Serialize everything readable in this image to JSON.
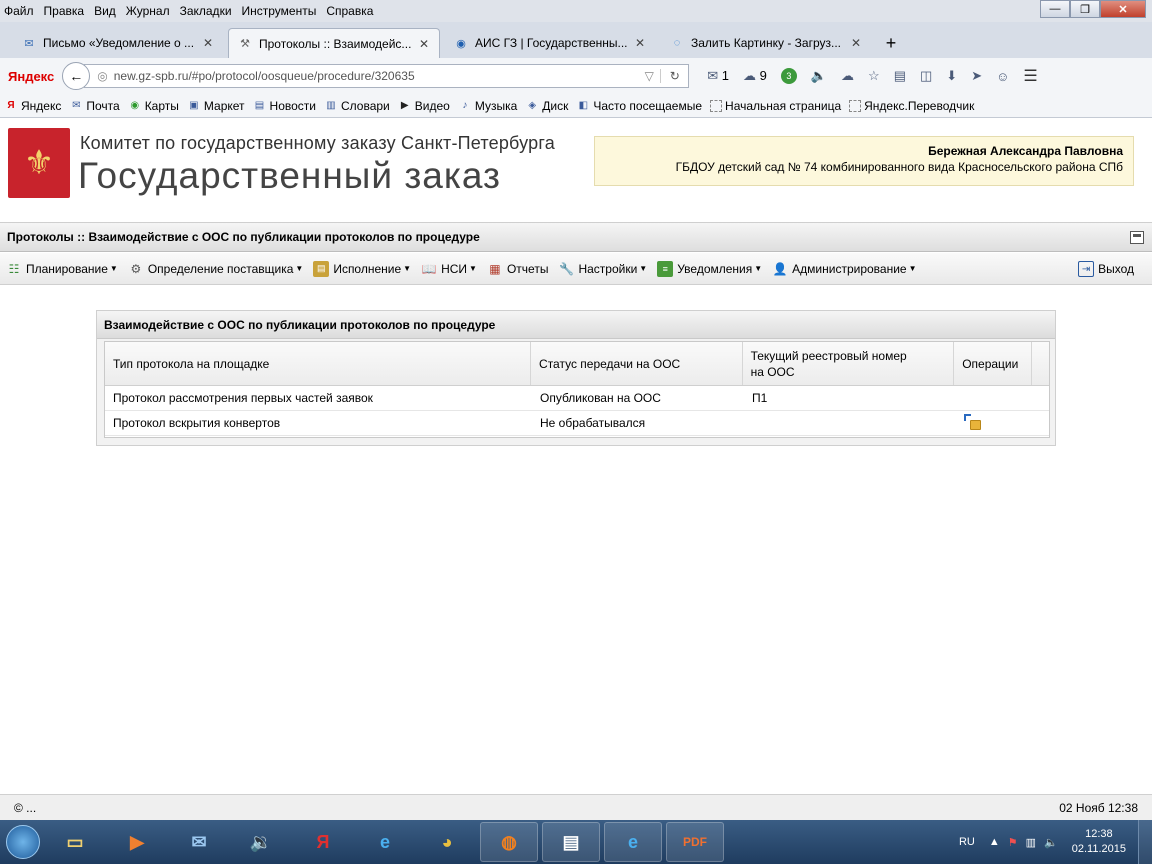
{
  "browser": {
    "menu": [
      "Файл",
      "Правка",
      "Вид",
      "Журнал",
      "Закладки",
      "Инструменты",
      "Справка"
    ],
    "tabs": [
      {
        "label": "Письмо «Уведомление о ...",
        "icon": "mail-icon",
        "active": false
      },
      {
        "label": "Протоколы :: Взаимодейс...",
        "icon": "hammer-icon",
        "active": true
      },
      {
        "label": "АИС ГЗ | Государственны...",
        "icon": "ais-icon",
        "active": false
      },
      {
        "label": "Залить Картинку - Загруз...",
        "icon": "loading-icon",
        "active": false
      }
    ],
    "yandex_label": "Яндекс",
    "url": "new.gz-spb.ru/#po/protocol/oosqueue/procedure/320635",
    "mail_count": "1",
    "weather_value": "9",
    "badge_value": "3",
    "bookmarks": [
      "Яндекс",
      "Почта",
      "Карты",
      "Маркет",
      "Новости",
      "Словари",
      "Видео",
      "Музыка",
      "Диск",
      "Часто посещаемые",
      "Начальная страница",
      "Яндекс.Переводчик"
    ]
  },
  "site": {
    "org_title": "Комитет по государственному заказу Санкт-Петербурга",
    "site_title": "Государственный заказ",
    "user_name": "Бережная Александра Павловна",
    "user_org": "ГБДОУ детский сад № 74 комбинированного вида Красносельского района СПб"
  },
  "page_title": "Протоколы :: Взаимодействие с ООС по публикации протоколов по процедуре",
  "main_menu": [
    {
      "label": "Планирование",
      "icon": "planning-icon",
      "dropdown": true
    },
    {
      "label": "Определение поставщика",
      "icon": "gears-icon",
      "dropdown": true
    },
    {
      "label": "Исполнение",
      "icon": "execution-icon",
      "dropdown": true
    },
    {
      "label": "НСИ",
      "icon": "book-icon",
      "dropdown": true
    },
    {
      "label": "Отчеты",
      "icon": "report-icon",
      "dropdown": false
    },
    {
      "label": "Настройки",
      "icon": "wrench-icon",
      "dropdown": true
    },
    {
      "label": "Уведомления",
      "icon": "notification-icon",
      "dropdown": true
    },
    {
      "label": "Администрирование",
      "icon": "user-admin-icon",
      "dropdown": true
    }
  ],
  "logout_label": "Выход",
  "panel": {
    "title": "Взаимодействие с ООС по публикации протоколов по процедуре",
    "columns": [
      "Тип протокола на площадке",
      "Статус передачи на ООС",
      "Текущий реестровый номер на ООС",
      "Операции"
    ],
    "rows": [
      {
        "type": "Протокол рассмотрения первых частей заявок",
        "status": "Опубликован на ООС",
        "number": "П1",
        "operation": ""
      },
      {
        "type": "Протокол вскрытия конвертов",
        "status": "Не обрабатывался",
        "number": "",
        "operation": "send-icon"
      }
    ]
  },
  "footer": {
    "copyright": "© ...",
    "datetime": "02 Нояб 12:38"
  },
  "taskbar": {
    "lang": "RU",
    "time": "12:38",
    "date": "02.11.2015"
  }
}
